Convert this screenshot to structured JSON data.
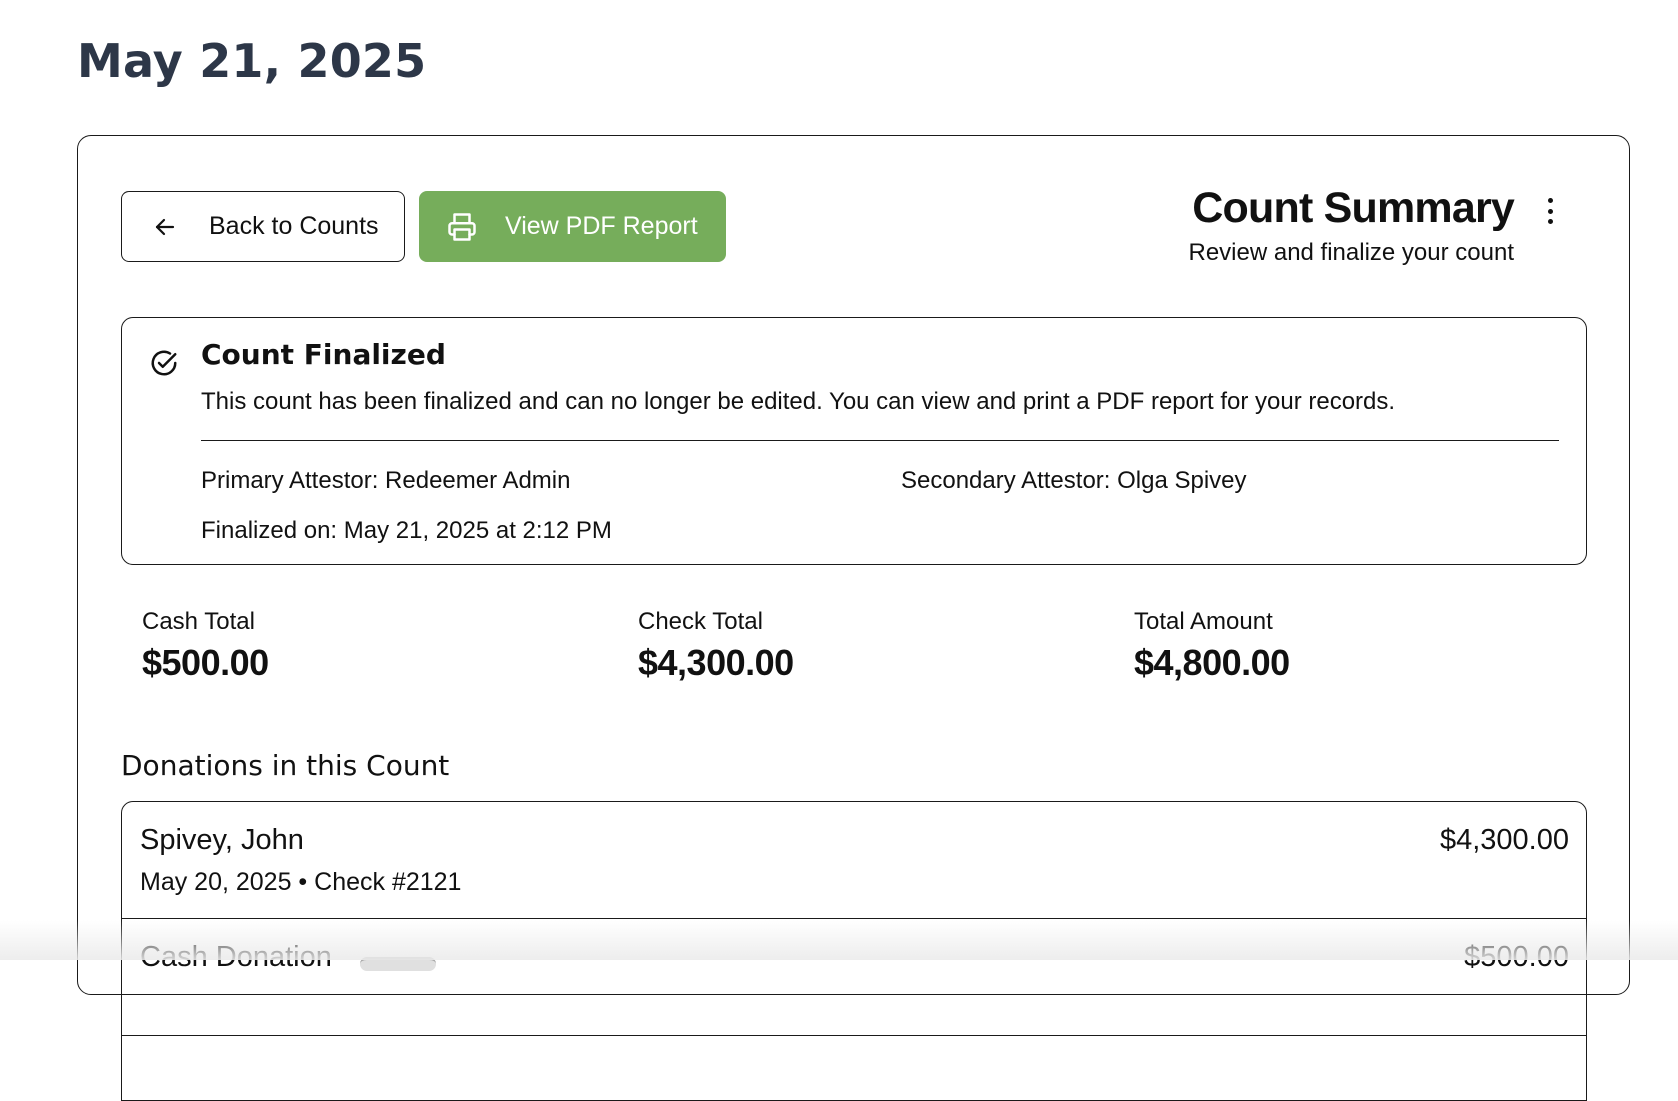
{
  "page": {
    "title": "May 21, 2025"
  },
  "toolbar": {
    "back_label": "Back to Counts",
    "pdf_label": "View PDF Report",
    "pdf_color": "#76ad5b"
  },
  "summary": {
    "title": "Count Summary",
    "subtitle": "Review and finalize your count"
  },
  "finalized": {
    "title": "Count Finalized",
    "message": "This count has been finalized and can no longer be edited. You can view and print a PDF report for your records.",
    "primary_attestor": "Primary Attestor: Redeemer Admin",
    "secondary_attestor": "Secondary Attestor: Olga Spivey",
    "finalized_on": "Finalized on: May 21, 2025 at 2:12 PM"
  },
  "totals": {
    "cash_label": "Cash Total",
    "cash_value": "$500.00",
    "check_label": "Check Total",
    "check_value": "$4,300.00",
    "total_label": "Total Amount",
    "total_value": "$4,800.00"
  },
  "donations": {
    "title": "Donations in this Count",
    "items": [
      {
        "name": "Spivey, John",
        "meta": "May 20, 2025 • Check #2121",
        "amount": "$4,300.00"
      },
      {
        "name": "Cash Donation",
        "meta": "",
        "amount": "$500.00"
      }
    ]
  }
}
